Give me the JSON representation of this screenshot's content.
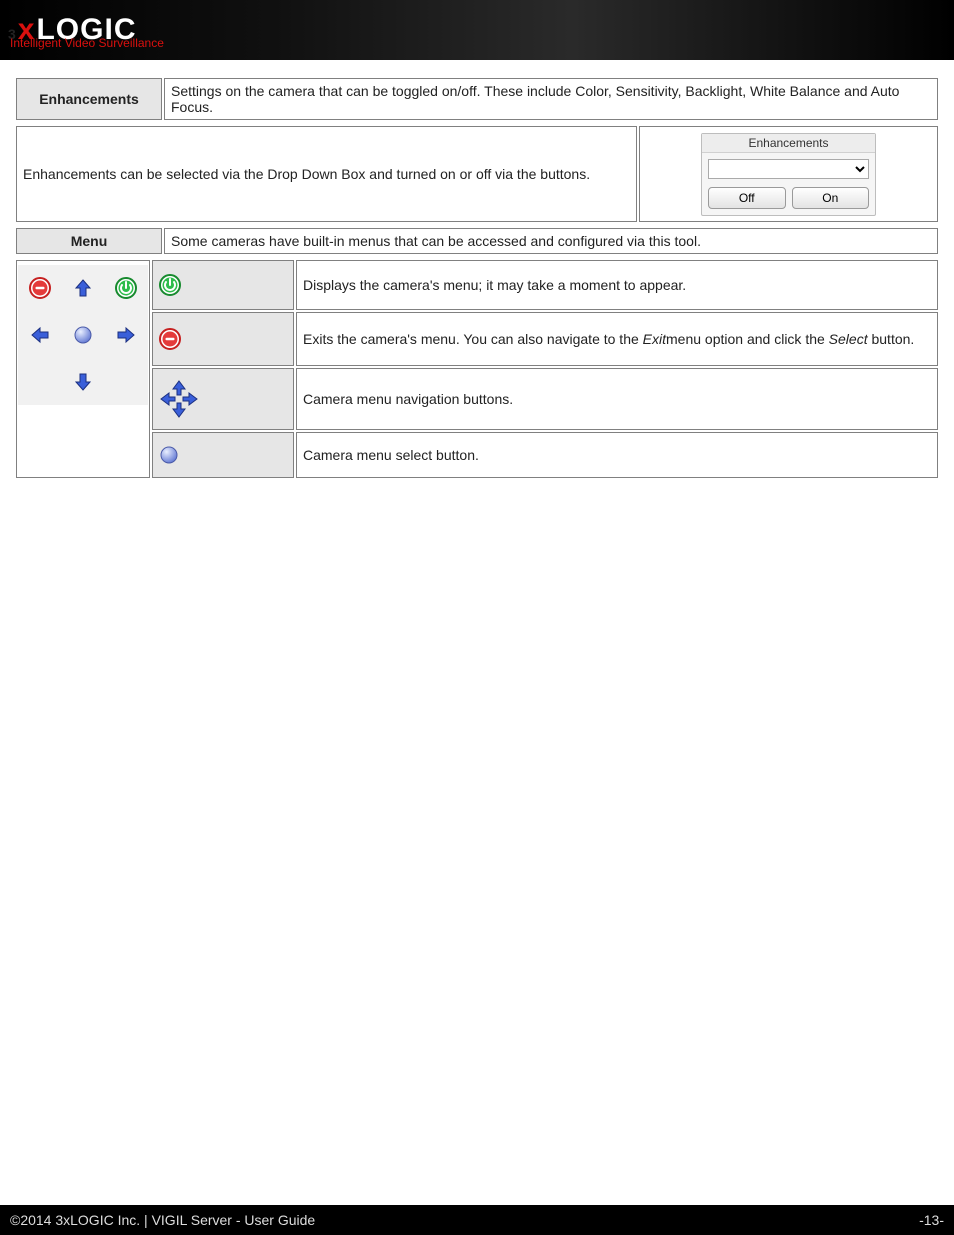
{
  "brand": {
    "three": "3",
    "x": "x",
    "logic": "LOGIC",
    "tagline": "Intelligent Video Surveillance"
  },
  "enh": {
    "title": "Enhancements",
    "desc": "Settings on the camera that can be toggled on/off. These include Color, Sensitivity, Backlight, White Balance and Auto Focus.",
    "instr": "Enhancements can be selected via the Drop Down Box and turned on or off via the buttons.",
    "widget_title": "Enhancements",
    "btn_off": "Off",
    "btn_on": "On"
  },
  "menu": {
    "title": "Menu",
    "desc": "Some cameras have built-in menus that can be accessed and configured via this tool.",
    "rows": {
      "display": "Displays the camera's menu; it may take a moment to appear.",
      "exit_pre": "Exits the camera's menu. You can also navigate to the ",
      "exit_em1": "Exit",
      "exit_mid": "menu option and click the ",
      "exit_em2": "Select",
      "exit_post": " button.",
      "nav": "Camera menu navigation buttons.",
      "select": "Camera menu select button."
    }
  },
  "footer": {
    "left": "©2014 3xLOGIC Inc.  |  VIGIL Server - User Guide",
    "right": "-13-"
  }
}
